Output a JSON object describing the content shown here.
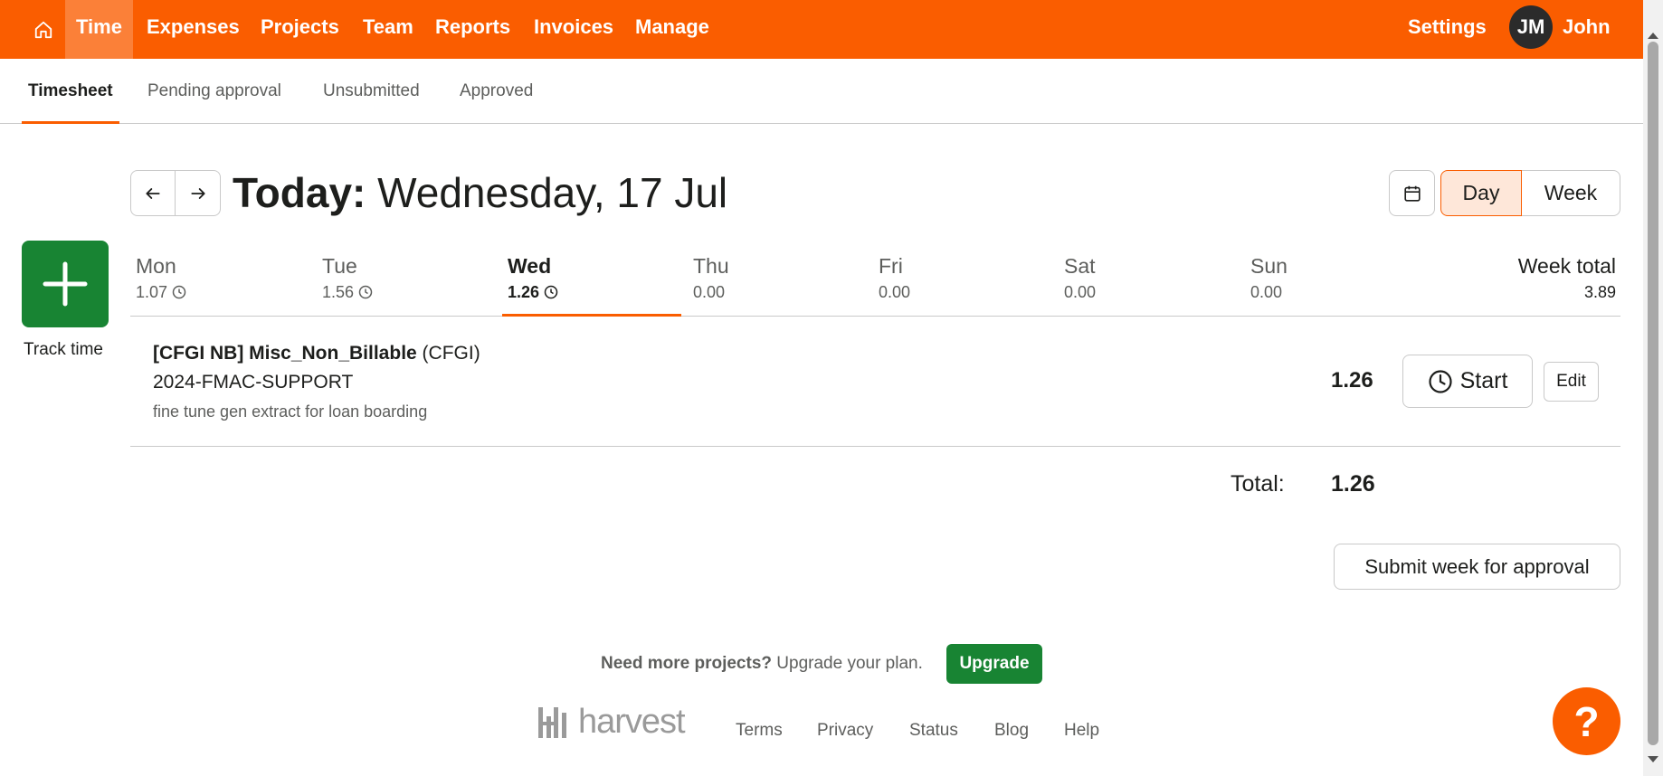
{
  "nav": {
    "items": [
      "Time",
      "Expenses",
      "Projects",
      "Team",
      "Reports",
      "Invoices",
      "Manage"
    ],
    "settings": "Settings",
    "avatar_initials": "JM",
    "user_name": "John",
    "accent_color": "#fa5d00"
  },
  "subtabs": [
    "Timesheet",
    "Pending approval",
    "Unsubmitted",
    "Approved"
  ],
  "header": {
    "title_prefix": "Today:",
    "title_date": "Wednesday, 17 Jul",
    "view_day": "Day",
    "view_week": "Week"
  },
  "track": {
    "label": "Track time"
  },
  "days": [
    {
      "name": "Mon",
      "hours": "1.07"
    },
    {
      "name": "Tue",
      "hours": "1.56"
    },
    {
      "name": "Wed",
      "hours": "1.26"
    },
    {
      "name": "Thu",
      "hours": "0.00"
    },
    {
      "name": "Fri",
      "hours": "0.00"
    },
    {
      "name": "Sat",
      "hours": "0.00"
    },
    {
      "name": "Sun",
      "hours": "0.00"
    }
  ],
  "week_total": {
    "label": "Week total",
    "value": "3.89"
  },
  "entry": {
    "project": "[CFGI NB] Misc_Non_Billable",
    "client": "(CFGI)",
    "task": "2024-FMAC-SUPPORT",
    "notes": "fine tune gen extract for loan boarding",
    "hours": "1.26",
    "start_label": "Start",
    "edit_label": "Edit"
  },
  "total": {
    "label": "Total:",
    "value": "1.26"
  },
  "submit_label": "Submit week for approval",
  "footer": {
    "upgrade_bold": "Need more projects?",
    "upgrade_text": "Upgrade your plan.",
    "upgrade_button": "Upgrade",
    "logo_text": "harvest",
    "links": [
      "Terms",
      "Privacy",
      "Status",
      "Blog",
      "Help"
    ]
  },
  "help_label": "?"
}
